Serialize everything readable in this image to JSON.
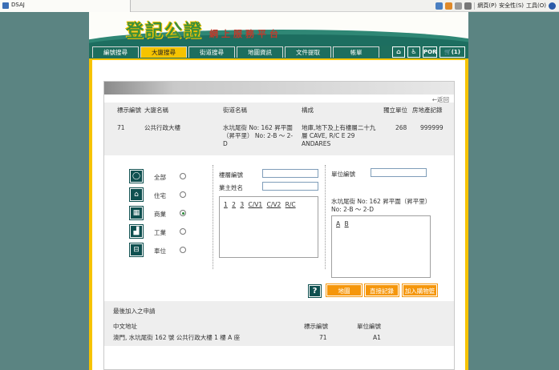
{
  "browser": {
    "tab_title": "DSAJ",
    "menus": [
      "網頁(P)",
      "安全性(S)",
      "工具(O)"
    ],
    "colors": {
      "favicon": "#3b6fb6"
    }
  },
  "site": {
    "logo_text": "登記公證",
    "slogan": "網上服務平台",
    "colors": {
      "frame": "#f6c300",
      "nav": "#1f6f5e",
      "logo": "#3c8f3a",
      "slogan": "#c0392b",
      "button": "#f5960b"
    }
  },
  "nav": {
    "tabs": [
      "編號搜尋",
      "大廈搜尋",
      "街道搜尋",
      "地圖資訊",
      "文件提取",
      "帳單"
    ],
    "active_tab": "大廈搜尋",
    "icons": [
      "home-icon",
      "wheelchair-icon",
      "por-icon",
      "cart-icon"
    ],
    "por_label": "POR",
    "cart_count": "(1)"
  },
  "back_link": "←返回",
  "building_table": {
    "headers": [
      "標示編號",
      "大廈名稱",
      "街道名稱",
      "構成",
      "獨立單位",
      "房地產記錄"
    ],
    "row": {
      "id": "71",
      "name": "公共行政大樓",
      "street": "水坑尾街 No: 162 昇平圍（昇平里） No: 2-B ～ 2-D",
      "composition": "地庫,地下及上有樓層二十九層 CAVE, R/C E 29 ANDARES",
      "units": "268",
      "record": "999999"
    }
  },
  "usage_options": [
    {
      "label": "全部",
      "icon": "circle-icon",
      "selected": false
    },
    {
      "label": "住宅",
      "icon": "house-icon",
      "selected": false
    },
    {
      "label": "商業",
      "icon": "building-icon",
      "selected": true
    },
    {
      "label": "工業",
      "icon": "factory-icon",
      "selected": false
    },
    {
      "label": "車位",
      "icon": "parking-icon",
      "selected": false
    }
  ],
  "search_form": {
    "floor_label": "樓層編號",
    "floor_value": "",
    "owner_label": "業主姓名",
    "owner_value": "",
    "floor_links": [
      "1",
      "2",
      "3",
      "C/V1",
      "C/V2",
      "R/C"
    ]
  },
  "unit_panel": {
    "unit_label": "單位編號",
    "unit_value": "",
    "address": "水坑尾街 No: 162 昇平圍（昇平里） No: 2-B ～ 2-D",
    "unit_links": [
      "A",
      "B"
    ]
  },
  "buttons": {
    "help": "?",
    "map": "地圖",
    "direct_record": "直接記錄",
    "add_cart": "加入購物籃"
  },
  "recent": {
    "title": "最後加入之申請",
    "headers": [
      "中文地址",
      "標示編號",
      "單位編號"
    ],
    "row": {
      "address": "澳門, 水坑尾街 162 號 公共行政大樓 1 樓 A 座",
      "id": "71",
      "unit": "A1"
    }
  }
}
